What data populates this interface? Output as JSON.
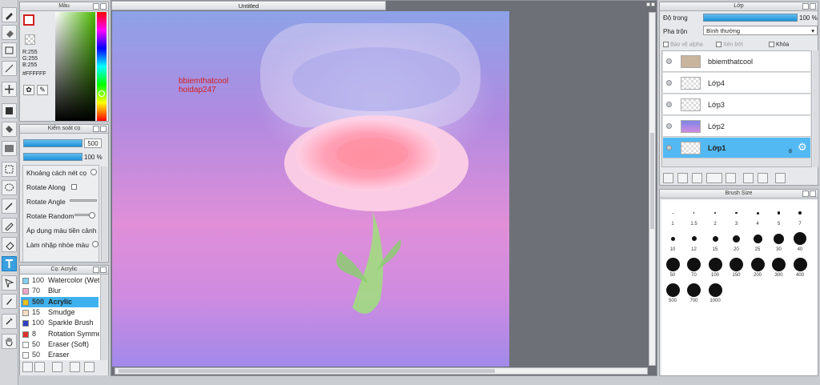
{
  "colors": {
    "accent": "#3aa0e0",
    "panel": "#e6e8eb",
    "brand_red": "#d21f1f"
  },
  "tools": [
    "brush-icon",
    "eraser-icon",
    "rectangle-icon",
    "line-icon",
    "move-icon",
    "fill-rect-icon",
    "bucket-icon",
    "gradient-icon",
    "select-rect-icon",
    "lasso-icon",
    "magic-wand-icon",
    "select-pen-icon",
    "select-eraser-icon",
    "text-icon",
    "transform-icon",
    "pen-icon",
    "eyedropper-icon",
    "hand-icon"
  ],
  "color_panel": {
    "title": "Màu",
    "r": "R:255",
    "g": "G:255",
    "b": "B:255",
    "hex": "#FFFFFF"
  },
  "brush_control": {
    "title": "Kiểm soát cọ",
    "size": "500",
    "opacity": "100 %",
    "rows": [
      "Khoảng cách nét cọ",
      "Rotate Along",
      "Rotate Angle",
      "Rotate Random",
      "Áp dụng màu tiền cảnh",
      "Làm nhập nhòe màu"
    ]
  },
  "brushes": {
    "title": "Cọ: Acrylic",
    "items": [
      {
        "size": "100",
        "name": "Watercolor (Wet)",
        "color": "#7fd1f2"
      },
      {
        "size": "70",
        "name": "Blur",
        "color": "#f4a6c8"
      },
      {
        "size": "500",
        "name": "Acrylic",
        "color": "#e6c21a",
        "selected": true
      },
      {
        "size": "15",
        "name": "Smudge",
        "color": "#f6dfc4"
      },
      {
        "size": "100",
        "name": "Sparkle Brush",
        "color": "#2e3fbf"
      },
      {
        "size": "8",
        "name": "Rotation Symmetry",
        "color": "#e23030"
      },
      {
        "size": "50",
        "name": "Eraser (Soft)",
        "color": "#ffffff"
      },
      {
        "size": "50",
        "name": "Eraser",
        "color": "#ffffff"
      }
    ]
  },
  "canvas": {
    "title": "Untitled",
    "text_line1": "bbiemthatcool",
    "text_line2": "hoidap247"
  },
  "layer_panel": {
    "title": "Lớp",
    "opacity_label": "Độ trong",
    "opacity_value": "100 %",
    "blend_label": "Pha trộn",
    "blend_value": "Bình thường",
    "protect_alpha": "Bảo vệ alpha",
    "clipping": "Xén bớt",
    "lock": "Khóa",
    "layers": [
      {
        "name": "bbiemthatcool"
      },
      {
        "name": "Lớp4"
      },
      {
        "name": "Lớp3"
      },
      {
        "name": "Lớp2"
      },
      {
        "name": "Lớp1",
        "selected": true,
        "badge": "8"
      }
    ]
  },
  "brush_size": {
    "title": "Brush Size",
    "sizes": [
      "1",
      "1.5",
      "2",
      "3",
      "4",
      "5",
      "7",
      "10",
      "12",
      "15",
      "20",
      "25",
      "30",
      "40",
      "50",
      "70",
      "100",
      "150",
      "200",
      "300",
      "400",
      "500",
      "700",
      "1000"
    ]
  }
}
